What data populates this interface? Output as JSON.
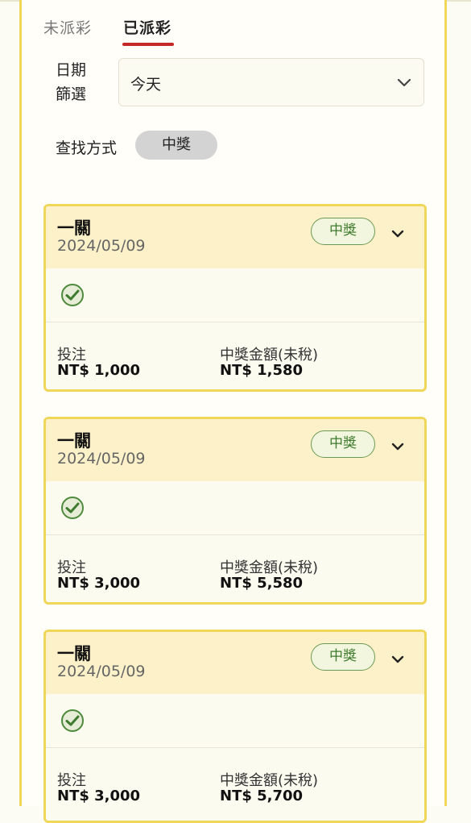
{
  "tabs": {
    "unsettled": "未派彩",
    "settled": "已派彩"
  },
  "filter": {
    "date_label": "日期\n篩選",
    "date_label_line1": "日期",
    "date_label_line2": "篩選",
    "date_value": "今天"
  },
  "search": {
    "label": "查找方式",
    "chip": "中獎"
  },
  "labels": {
    "bet": "投注",
    "winnings": "中獎金額(未稅)"
  },
  "cards": [
    {
      "title": "一關",
      "date": "2024/05/09",
      "status": "中獎",
      "bet": "NT$ 1,000",
      "winnings": "NT$ 1,580"
    },
    {
      "title": "一關",
      "date": "2024/05/09",
      "status": "中獎",
      "bet": "NT$ 3,000",
      "winnings": "NT$ 5,580"
    },
    {
      "title": "一關",
      "date": "2024/05/09",
      "status": "中獎",
      "bet": "NT$ 3,000",
      "winnings": "NT$ 5,700"
    }
  ],
  "colors": {
    "accent_border": "#f0d75a",
    "tab_underline": "#c62828",
    "win_green": "#3f7b2e",
    "card_header": "#fcf1c8"
  }
}
